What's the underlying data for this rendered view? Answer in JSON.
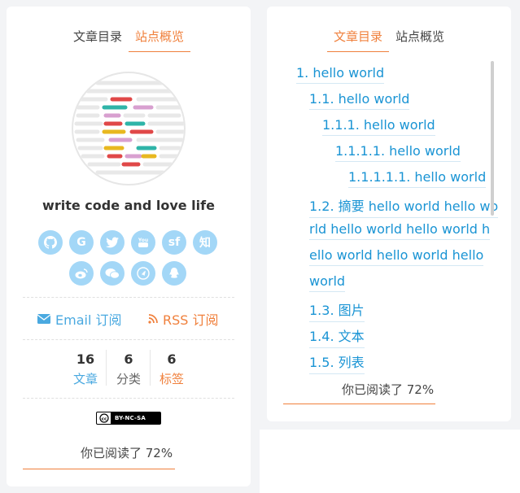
{
  "left_panel": {
    "tabs": [
      {
        "label": "文章目录",
        "active": false
      },
      {
        "label": "站点概览",
        "active": true
      }
    ],
    "author": "write code and love life",
    "social": [
      {
        "name": "github",
        "glyph": ""
      },
      {
        "name": "google",
        "glyph": "G"
      },
      {
        "name": "twitter",
        "glyph": ""
      },
      {
        "name": "youtube",
        "glyph": ""
      },
      {
        "name": "segmentfault",
        "glyph": "sf"
      },
      {
        "name": "zhihu",
        "glyph": "知"
      },
      {
        "name": "weibo",
        "glyph": ""
      },
      {
        "name": "wechat",
        "glyph": ""
      },
      {
        "name": "telegram",
        "glyph": ""
      },
      {
        "name": "qq",
        "glyph": ""
      }
    ],
    "subscribe": {
      "email": "Email 订阅",
      "rss": "RSS 订阅"
    },
    "stats": [
      {
        "num": "16",
        "label": "文章",
        "color": "#4aa9e0"
      },
      {
        "num": "6",
        "label": "分类",
        "color": "#666666"
      },
      {
        "num": "6",
        "label": "标签",
        "color": "#f0803c"
      }
    ],
    "license": "BY-NC-SA",
    "progress": {
      "text": "你已阅读了 72%",
      "fraction": 0.72
    }
  },
  "right_panel": {
    "tabs": [
      {
        "label": "文章目录",
        "active": true
      },
      {
        "label": "站点概览",
        "active": false
      }
    ],
    "toc": [
      {
        "text": "1. hello world",
        "level": 0
      },
      {
        "text": "1.1. hello world",
        "level": 1
      },
      {
        "text": "1.1.1. hello world",
        "level": 2
      },
      {
        "text": "1.1.1.1. hello world",
        "level": 3
      },
      {
        "text": "1.1.1.1.1. hello world",
        "level": 4
      },
      {
        "text": "1.2. 摘要 hello world hello wo",
        "level": 1
      },
      {
        "text": "rld hello world hello world h",
        "level": 1
      },
      {
        "text": "ello world hello world hello",
        "level": 1
      },
      {
        "text": "world",
        "level": 1
      },
      {
        "text": "1.3. 图片",
        "level": 1
      },
      {
        "text": "1.4. 文本",
        "level": 1
      },
      {
        "text": "1.5. 列表",
        "level": 1
      }
    ],
    "progress": {
      "text": "你已阅读了 72%",
      "fraction": 0.72
    }
  },
  "colors": {
    "accent": "#f0803c",
    "link": "#1a94d4",
    "social": "#a3d7f7"
  }
}
